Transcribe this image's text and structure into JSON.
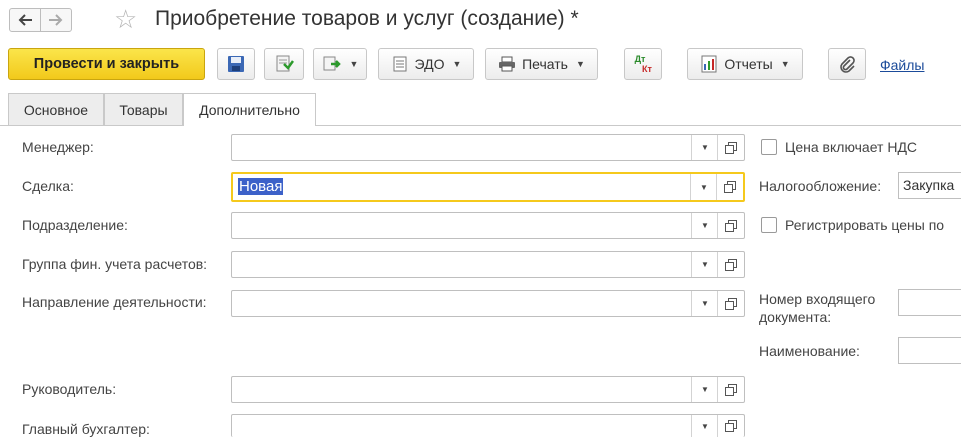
{
  "header": {
    "title": "Приобретение товаров и услуг (создание) *",
    "back_icon": "arrow-left-icon",
    "forward_icon": "arrow-right-icon",
    "favorite_icon": "star-icon"
  },
  "toolbar": {
    "post_close_label": "Провести и закрыть",
    "edo_label": "ЭДО",
    "print_label": "Печать",
    "dtkt_top": "Дт",
    "dtkt_bottom": "Кт",
    "reports_label": "Отчеты",
    "files_label": "Файлы",
    "accent_color": "#f5c91c"
  },
  "tabs": [
    {
      "label": "Основное",
      "active": false
    },
    {
      "label": "Товары",
      "active": false
    },
    {
      "label": "Дополнительно",
      "active": true
    }
  ],
  "form": {
    "fields": [
      {
        "label": "Менеджер:",
        "value": ""
      },
      {
        "label": "Сделка:",
        "value": "Новая"
      },
      {
        "label": "Подразделение:",
        "value": ""
      },
      {
        "label": "Группа фин. учета расчетов:",
        "value": ""
      },
      {
        "label": "Направление деятельности:",
        "value": ""
      },
      {
        "label": "Руководитель:",
        "value": ""
      },
      {
        "label": "Главный бухгалтер:",
        "value": ""
      }
    ],
    "right": {
      "price_includes_vat": "Цена включает НДС",
      "taxation_label": "Налогообложение:",
      "taxation_value": "Закупка",
      "register_prices": "Регистрировать цены по",
      "incoming_doc_number_line1": "Номер входящего",
      "incoming_doc_number_line2": "документа:",
      "name_label": "Наименование:"
    }
  }
}
